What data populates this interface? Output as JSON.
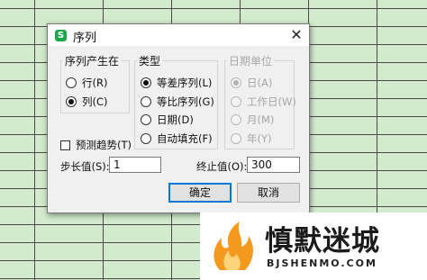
{
  "dialog": {
    "title": "序列",
    "app_icon_letter": "S",
    "close_glyph": "✕",
    "group_series_in": {
      "legend": "序列产生在",
      "options": [
        "行(R)",
        "列(C)"
      ],
      "selected": 1
    },
    "group_type": {
      "legend": "类型",
      "options": [
        "等差序列(L)",
        "等比序列(G)",
        "日期(D)",
        "自动填充(F)"
      ],
      "selected": 0
    },
    "group_date_unit": {
      "legend": "日期单位",
      "options": [
        "日(A)",
        "工作日(W)",
        "月(M)",
        "年(Y)"
      ],
      "selected": 0,
      "disabled": true
    },
    "trend_checkbox": {
      "label": "预测趋势(T)",
      "checked": false
    },
    "step": {
      "label": "步长值(S):",
      "value": "1"
    },
    "stop": {
      "label": "终止值(O):",
      "value": "300"
    },
    "ok_label": "确定",
    "cancel_label": "取消"
  },
  "watermark": {
    "name": "慎默迷城",
    "domain": "BJSHENMO.COM"
  },
  "colors": {
    "sheet_background": "#d2ebcd",
    "accent_border": "#0078d7",
    "app_icon": "#1aa84b",
    "logo_orange": "#f39a1e"
  }
}
